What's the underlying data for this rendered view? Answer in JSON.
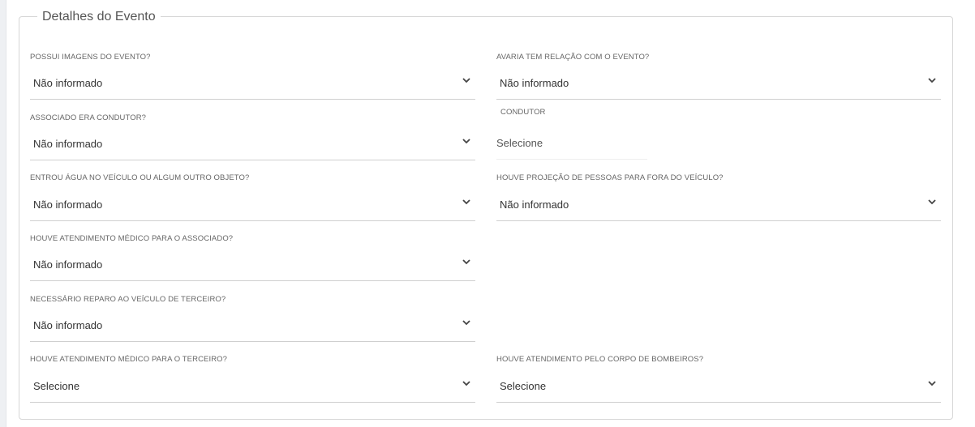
{
  "section": {
    "title": "Detalhes do Evento"
  },
  "fields": {
    "possui_imagens": {
      "label": "POSSUI IMAGENS DO EVENTO?",
      "value": "Não informado"
    },
    "avaria_relacao": {
      "label": "AVARIA TEM RELAÇÃO COM O EVENTO?",
      "value": "Não informado"
    },
    "associado_condutor": {
      "label": "ASSOCIADO ERA CONDUTOR?",
      "value": "Não informado"
    },
    "condutor": {
      "label": "CONDUTOR",
      "value": "Selecione"
    },
    "entrou_agua": {
      "label": "ENTROU ÁGUA NO VEÍCULO OU ALGUM OUTRO OBJETO?",
      "value": "Não informado"
    },
    "projecao_pessoas": {
      "label": "HOUVE PROJEÇÃO DE PESSOAS PARA FORA DO VEÍCULO?",
      "value": "Não informado"
    },
    "atendimento_associado": {
      "label": "HOUVE ATENDIMENTO MÉDICO PARA O ASSOCIADO?",
      "value": "Não informado"
    },
    "reparo_terceiro": {
      "label": "NECESSÁRIO REPARO AO VEÍCULO DE TERCEIRO?",
      "value": "Não informado"
    },
    "atendimento_terceiro": {
      "label": "HOUVE ATENDIMENTO MÉDICO PARA O TERCEIRO?",
      "value": "Selecione"
    },
    "corpo_bombeiros": {
      "label": "HOUVE ATENDIMENTO PELO CORPO DE BOMBEIROS?",
      "value": "Selecione"
    }
  },
  "icons": {
    "dropdown": "chevron-down-icon"
  }
}
